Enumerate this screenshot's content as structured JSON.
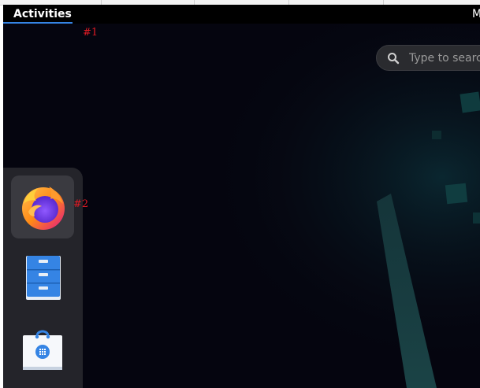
{
  "topbar": {
    "activities_label": "Activities",
    "clock_stub": "M"
  },
  "markers": {
    "m1": "#1",
    "m2": "#2"
  },
  "search": {
    "placeholder": "Type to search"
  },
  "dash": {
    "items": [
      {
        "name": "Firefox",
        "icon": "firefox-icon"
      },
      {
        "name": "Files",
        "icon": "file-cabinet-icon"
      },
      {
        "name": "Software",
        "icon": "software-store-icon"
      }
    ]
  },
  "colors": {
    "accent": "#3584e4",
    "marker": "#e01b24",
    "wallpaper": "#05050f",
    "dash_bg": "#24242a"
  }
}
